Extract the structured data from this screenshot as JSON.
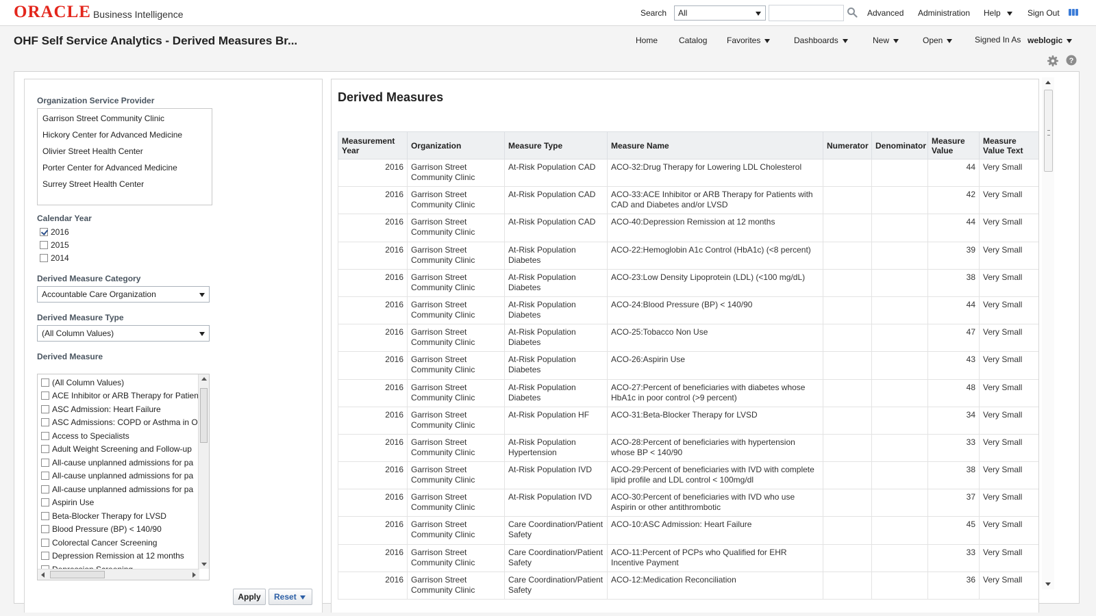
{
  "header": {
    "logo_text": "ORACLE",
    "product_name": "Business Intelligence",
    "search_label": "Search",
    "search_scope": "All",
    "search_placeholder": "",
    "nav_advanced": "Advanced",
    "nav_administration": "Administration",
    "nav_help": "Help",
    "nav_signout": "Sign Out"
  },
  "titlebar": {
    "page_title": "OHF Self Service Analytics - Derived Measures Br...",
    "nav_home": "Home",
    "nav_catalog": "Catalog",
    "nav_favorites": "Favorites",
    "nav_dashboards": "Dashboards",
    "nav_new": "New",
    "nav_open": "Open",
    "signed_in_label": "Signed In As",
    "signed_in_user": "weblogic"
  },
  "prompts": {
    "org_label": "Organization Service Provider",
    "orgs": [
      "Garrison Street Community Clinic",
      "Hickory Center for Advanced Medicine",
      "Olivier Street Health Center",
      "Porter Center for Advanced Medicine",
      "Surrey Street Health Center"
    ],
    "year_label": "Calendar Year",
    "years": [
      {
        "label": "2016",
        "checked": true
      },
      {
        "label": "2015",
        "checked": false
      },
      {
        "label": "2014",
        "checked": false
      }
    ],
    "category_label": "Derived Measure Category",
    "category_value": "Accountable Care Organization",
    "type_label": "Derived Measure Type",
    "type_value": "(All Column Values)",
    "measure_label": "Derived Measure",
    "measures": [
      "(All Column Values)",
      "ACE Inhibitor or ARB Therapy for Patient",
      "ASC Admission: Heart Failure",
      "ASC Admissions: COPD or Asthma in O",
      "Access to Specialists",
      "Adult Weight Screening and Follow-up",
      "All-cause unplanned admissions for pa",
      "All-cause unplanned admissions for pa",
      "All-cause unplanned admissions for pa",
      "Aspirin Use",
      "Beta-Blocker Therapy for LVSD",
      "Blood Pressure (BP) < 140/90",
      "Colorectal Cancer Screening",
      "Depression Remission at 12 months",
      "Depression Screening"
    ],
    "apply_label": "Apply",
    "reset_label": "Reset"
  },
  "results": {
    "title": "Derived Measures",
    "columns": [
      "Measurement Year",
      "Organization",
      "Measure Type",
      "Measure Name",
      "Numerator",
      "Denominator",
      "Measure Value",
      "Measure Value Text"
    ],
    "rows": [
      {
        "year": "2016",
        "org": "Garrison Street Community Clinic",
        "type": "At-Risk Population CAD",
        "name": "ACO-32:Drug Therapy for Lowering LDL Cholesterol",
        "numerator": "",
        "denominator": "",
        "value": "44",
        "value_text": "Very Small"
      },
      {
        "year": "2016",
        "org": "Garrison Street Community Clinic",
        "type": "At-Risk Population CAD",
        "name": "ACO-33:ACE Inhibitor or ARB Therapy for Patients with CAD and Diabetes and/or LVSD",
        "numerator": "",
        "denominator": "",
        "value": "42",
        "value_text": "Very Small"
      },
      {
        "year": "2016",
        "org": "Garrison Street Community Clinic",
        "type": "At-Risk Population CAD",
        "name": "ACO-40:Depression Remission at 12 months",
        "numerator": "",
        "denominator": "",
        "value": "44",
        "value_text": "Very Small"
      },
      {
        "year": "2016",
        "org": "Garrison Street Community Clinic",
        "type": "At-Risk Population Diabetes",
        "name": "ACO-22:Hemoglobin A1c Control (HbA1c) (<8 percent)",
        "numerator": "",
        "denominator": "",
        "value": "39",
        "value_text": "Very Small"
      },
      {
        "year": "2016",
        "org": "Garrison Street Community Clinic",
        "type": "At-Risk Population Diabetes",
        "name": "ACO-23:Low Density Lipoprotein (LDL) (<100 mg/dL)",
        "numerator": "",
        "denominator": "",
        "value": "38",
        "value_text": "Very Small"
      },
      {
        "year": "2016",
        "org": "Garrison Street Community Clinic",
        "type": "At-Risk Population Diabetes",
        "name": "ACO-24:Blood Pressure (BP) < 140/90",
        "numerator": "",
        "denominator": "",
        "value": "44",
        "value_text": "Very Small"
      },
      {
        "year": "2016",
        "org": "Garrison Street Community Clinic",
        "type": "At-Risk Population Diabetes",
        "name": "ACO-25:Tobacco Non Use",
        "numerator": "",
        "denominator": "",
        "value": "47",
        "value_text": "Very Small"
      },
      {
        "year": "2016",
        "org": "Garrison Street Community Clinic",
        "type": "At-Risk Population Diabetes",
        "name": "ACO-26:Aspirin Use",
        "numerator": "",
        "denominator": "",
        "value": "43",
        "value_text": "Very Small"
      },
      {
        "year": "2016",
        "org": "Garrison Street Community Clinic",
        "type": "At-Risk Population Diabetes",
        "name": "ACO-27:Percent of beneficiaries with diabetes whose HbA1c in poor control (>9 percent)",
        "numerator": "",
        "denominator": "",
        "value": "48",
        "value_text": "Very Small"
      },
      {
        "year": "2016",
        "org": "Garrison Street Community Clinic",
        "type": "At-Risk Population HF",
        "name": "ACO-31:Beta-Blocker Therapy for LVSD",
        "numerator": "",
        "denominator": "",
        "value": "34",
        "value_text": "Very Small"
      },
      {
        "year": "2016",
        "org": "Garrison Street Community Clinic",
        "type": "At-Risk Population Hypertension",
        "name": "ACO-28:Percent of beneficiaries with hypertension whose BP < 140/90",
        "numerator": "",
        "denominator": "",
        "value": "33",
        "value_text": "Very Small"
      },
      {
        "year": "2016",
        "org": "Garrison Street Community Clinic",
        "type": "At-Risk Population IVD",
        "name": "ACO-29:Percent of beneficiaries with IVD with complete lipid profile and LDL control < 100mg/dl",
        "numerator": "",
        "denominator": "",
        "value": "38",
        "value_text": "Very Small"
      },
      {
        "year": "2016",
        "org": "Garrison Street Community Clinic",
        "type": "At-Risk Population IVD",
        "name": "ACO-30:Percent of beneficiaries with IVD who use Aspirin or other antithrombotic",
        "numerator": "",
        "denominator": "",
        "value": "37",
        "value_text": "Very Small"
      },
      {
        "year": "2016",
        "org": "Garrison Street Community Clinic",
        "type": "Care Coordination/Patient Safety",
        "name": "ACO-10:ASC Admission: Heart Failure",
        "numerator": "",
        "denominator": "",
        "value": "45",
        "value_text": "Very Small"
      },
      {
        "year": "2016",
        "org": "Garrison Street Community Clinic",
        "type": "Care Coordination/Patient Safety",
        "name": "ACO-11:Percent of PCPs who Qualified for EHR Incentive Payment",
        "numerator": "",
        "denominator": "",
        "value": "33",
        "value_text": "Very Small"
      },
      {
        "year": "2016",
        "org": "Garrison Street Community Clinic",
        "type": "Care Coordination/Patient Safety",
        "name": "ACO-12:Medication Reconciliation",
        "numerator": "",
        "denominator": "",
        "value": "36",
        "value_text": "Very Small"
      }
    ]
  },
  "colors": {
    "brand_red": "#e3261c",
    "header_bg": "#ffffff",
    "table_header_bg": "#eef0f2",
    "link_blue": "#2d5fa6"
  }
}
